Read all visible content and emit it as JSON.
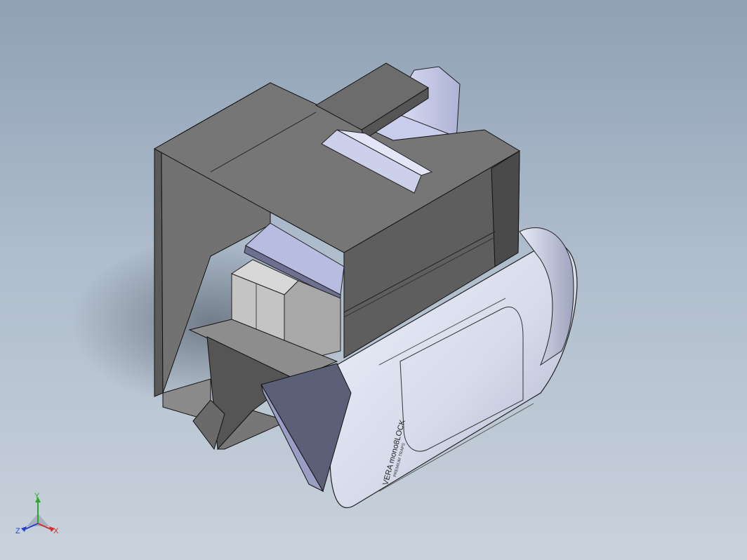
{
  "viewport": {
    "background_top": "#8fa1b5",
    "background_bottom": "#c9d2dc"
  },
  "model": {
    "label_line1": "VERA mono8LOCK",
    "label_line2": "PREMIUM TRAPS",
    "housing_color": "#6e6e6e",
    "tank_color": "#dfe3f2",
    "insert_color": "#cfd4ee"
  },
  "triad": {
    "x_label": "X",
    "y_label": "Y",
    "z_label": "Z",
    "x_color": "#d03030",
    "y_color": "#2aa82a",
    "z_color": "#2a3fd0"
  }
}
